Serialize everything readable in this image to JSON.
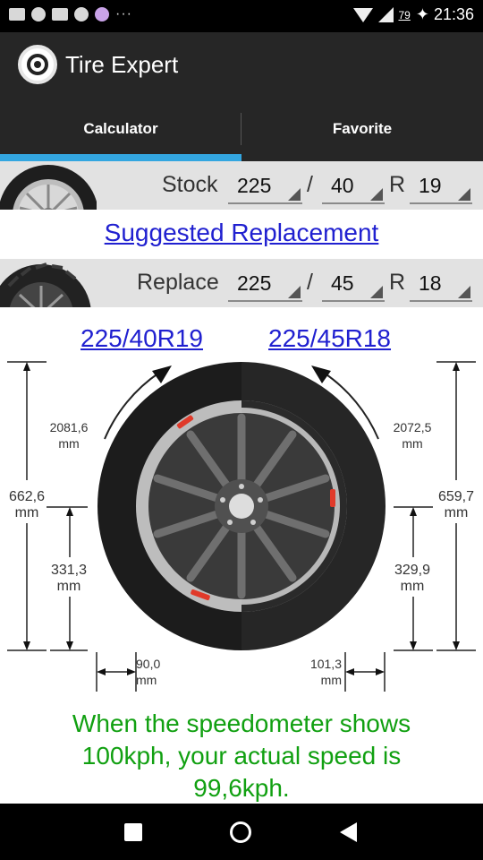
{
  "status_bar": {
    "battery": "79",
    "time": "21:36"
  },
  "app": {
    "title": "Tire Expert"
  },
  "tabs": [
    {
      "label": "Calculator",
      "selected": true
    },
    {
      "label": "Favorite",
      "selected": false
    }
  ],
  "stock": {
    "label": "Stock",
    "width": "225",
    "separator": "/",
    "aspect": "40",
    "rim_prefix": "R",
    "rim": "19"
  },
  "suggested_link": "Suggested Replacement",
  "replace": {
    "label": "Replace",
    "width": "225",
    "separator": "/",
    "aspect": "45",
    "rim_prefix": "R",
    "rim": "18"
  },
  "diagram": {
    "stock_size": "225/40R19",
    "replace_size": "225/45R18",
    "stock_circumference": "2081,6",
    "replace_circumference": "2072,5",
    "stock_diameter": "662,6",
    "replace_diameter": "659,7",
    "stock_sidewall": "331,3",
    "replace_sidewall": "329,9",
    "stock_sidewall_height": "90,0",
    "replace_sidewall_height": "101,3",
    "unit": "mm"
  },
  "speed_message": {
    "line1": "When the speedometer shows",
    "line2": "100kph, your actual speed is",
    "line3": "99,6kph."
  },
  "colors": {
    "accent": "#33a6e0",
    "link": "#2020d0",
    "message": "#11a011",
    "header": "#262626"
  }
}
